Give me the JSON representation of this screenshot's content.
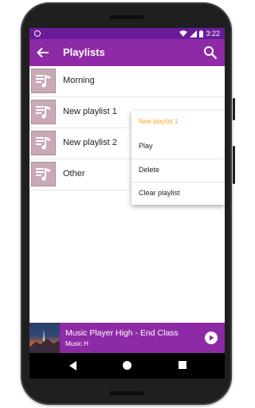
{
  "status_bar": {
    "time": "3:22",
    "icons": [
      "notification-dot-icon",
      "wifi-icon",
      "signal-icon",
      "battery-icon"
    ]
  },
  "app_bar": {
    "title": "Playlists",
    "back_icon": "arrow-left-icon",
    "search_icon": "search-icon"
  },
  "playlists": [
    {
      "name": "Morning"
    },
    {
      "name": "New playlist 1"
    },
    {
      "name": "New playlist 2"
    },
    {
      "name": "Other"
    }
  ],
  "context_menu": {
    "title": "New playlist 1",
    "options": [
      "Play",
      "Delete",
      "Clear playlist"
    ]
  },
  "now_playing": {
    "song": "Music Player High - End Class",
    "artist": "Music H",
    "play_icon": "play-circle-icon"
  },
  "colors": {
    "primary": "#8e2aa6",
    "primary_dark": "#6a1b9a",
    "accent": "#f5a623",
    "thumbnail": "#c9a9b8"
  }
}
